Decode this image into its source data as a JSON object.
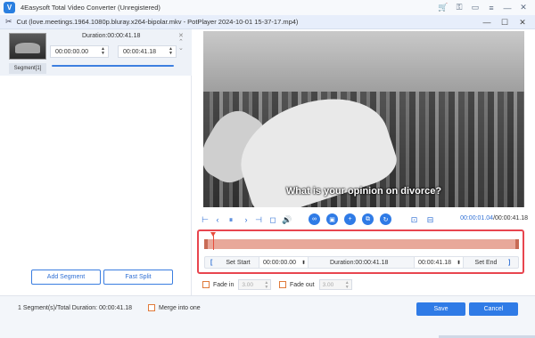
{
  "app": {
    "logo": "V",
    "title": "4Easysoft Total Video Converter (Unregistered)",
    "title_icons": [
      "cart-icon",
      "key-icon",
      "chat-icon",
      "menu-icon",
      "minimize-icon",
      "close-icon"
    ]
  },
  "cut_window": {
    "title": "Cut (love.meetings.1964.1080p.bluray.x264-bipolar.mkv - PotPlayer 2024-10-01 15-37-17.mp4)"
  },
  "segment": {
    "label": "Segment[1]",
    "duration": "Duration:00:00:41.18",
    "start": "00:00:00.00",
    "end": "00:00:41.18"
  },
  "left_buttons": {
    "add_segment": "Add Segment",
    "fast_split": "Fast Split"
  },
  "video": {
    "subtitle": "What is your opinion on divorce?"
  },
  "playback": {
    "current_time": "00:00:01.04",
    "total_time": "/00:00:41.18"
  },
  "cut_controls": {
    "set_start": "Set Start",
    "start_time": "00:00:00.00",
    "duration": "Duration:00:00:41.18",
    "end_time": "00:00:41.18",
    "set_end": "Set End",
    "open_bracket": "[",
    "close_bracket": "]"
  },
  "fade": {
    "fade_in_label": "Fade in",
    "fade_in_value": "3.00",
    "fade_out_label": "Fade out",
    "fade_out_value": "3.00"
  },
  "footer": {
    "summary": "1 Segment(s)/Total Duration: 00:00:41.18",
    "merge_label": "Merge into one",
    "save": "Save",
    "cancel": "Cancel"
  },
  "colors": {
    "accent": "#2f7be6",
    "highlight_border": "#e8454f",
    "checkbox_border": "#e07a3a"
  }
}
